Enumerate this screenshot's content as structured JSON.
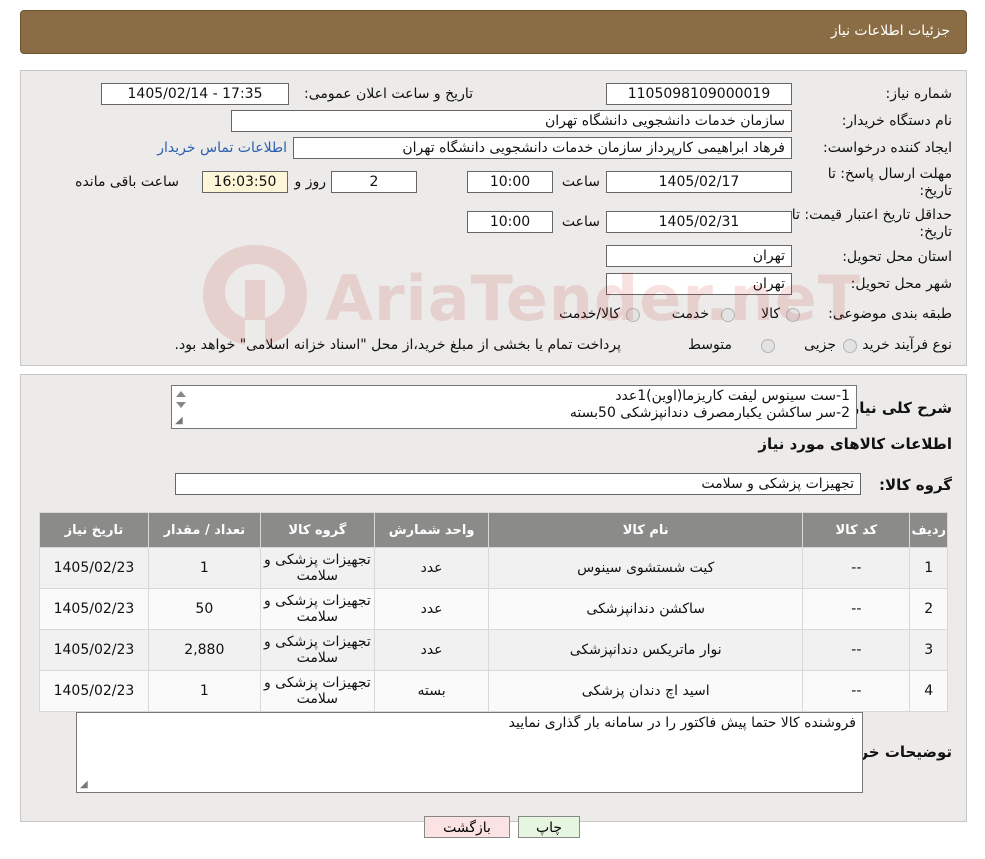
{
  "header": {
    "title": "جزئیات اطلاعات نیاز"
  },
  "watermark": {
    "text": "AriaTender.neT"
  },
  "form": {
    "need_number_label": "شماره نیاز:",
    "need_number": "1105098109000019",
    "announce_label": "تاریخ و ساعت اعلان عمومی:",
    "announce_value": "1405/02/14 - 17:35",
    "buyer_org_label": "نام دستگاه خریدار:",
    "buyer_org": "سازمان خدمات دانشجویی دانشگاه تهران",
    "creator_label": "ایجاد کننده درخواست:",
    "creator": "فرهاد ابراهیمی کارپرداز سازمان خدمات دانشجویی دانشگاه تهران",
    "contact_link": "اطلاعات تماس خریدار",
    "deadline_label": "مهلت ارسال پاسخ: تا تاریخ:",
    "deadline_date": "1405/02/17",
    "time_label": "ساعت",
    "deadline_time": "10:00",
    "days_value": "2",
    "days_label": "روز و",
    "remaining_time": "16:03:50",
    "remaining_label": "ساعت باقی مانده",
    "validity_label": "حداقل تاریخ اعتبار قیمت: تا تاریخ:",
    "validity_date": "1405/02/31",
    "validity_time": "10:00",
    "province_label": "استان محل تحویل:",
    "province": "تهران",
    "city_label": "شهر محل تحویل:",
    "city": "تهران",
    "category_label": "طبقه بندی موضوعی:",
    "category_options": [
      "کالا",
      "خدمت",
      "کالا/خدمت"
    ],
    "process_label": "نوع فرآیند خرید :",
    "process_options": [
      "جزیی",
      "متوسط"
    ],
    "process_note": "پرداخت تمام یا بخشی از مبلغ خرید،از محل \"اسناد خزانه اسلامی\" خواهد بود."
  },
  "details": {
    "summary_label": "شرح کلی نیاز:",
    "summary_lines": [
      "1-ست سینوس لیفت کاریزما(اوین)1عدد",
      "2-سر ساکشن یکبارمصرف دندانپزشکی 50بسته"
    ],
    "goods_info_title": "اطلاعات کالاهای مورد نیاز",
    "goods_group_label": "گروه کالا:",
    "goods_group": "تجهیزات پزشکی و سلامت",
    "table": {
      "headers": [
        "ردیف",
        "کد کالا",
        "نام کالا",
        "واحد شمارش",
        "گروه کالا",
        "تعداد / مقدار",
        "تاریخ نیاز"
      ],
      "rows": [
        [
          "1",
          "--",
          "کیت شستشوی سینوس",
          "عدد",
          "تجهیزات پزشکی و سلامت",
          "1",
          "1405/02/23"
        ],
        [
          "2",
          "--",
          "ساکشن دندانپزشکی",
          "عدد",
          "تجهیزات پزشکی و سلامت",
          "50",
          "1405/02/23"
        ],
        [
          "3",
          "--",
          "نوار ماتریکس دندانپزشکی",
          "عدد",
          "تجهیزات پزشکی و سلامت",
          "2,880",
          "1405/02/23"
        ],
        [
          "4",
          "--",
          "اسید اچ دندان پزشکی",
          "بسته",
          "تجهیزات پزشکی و سلامت",
          "1",
          "1405/02/23"
        ]
      ]
    },
    "buyer_notes_label": "توضیحات خریدار:",
    "buyer_notes": "فروشنده کالا حتما پیش فاکتور را در سامانه بار گذاری نمایید"
  },
  "buttons": {
    "print": "چاپ",
    "back": "بازگشت"
  }
}
